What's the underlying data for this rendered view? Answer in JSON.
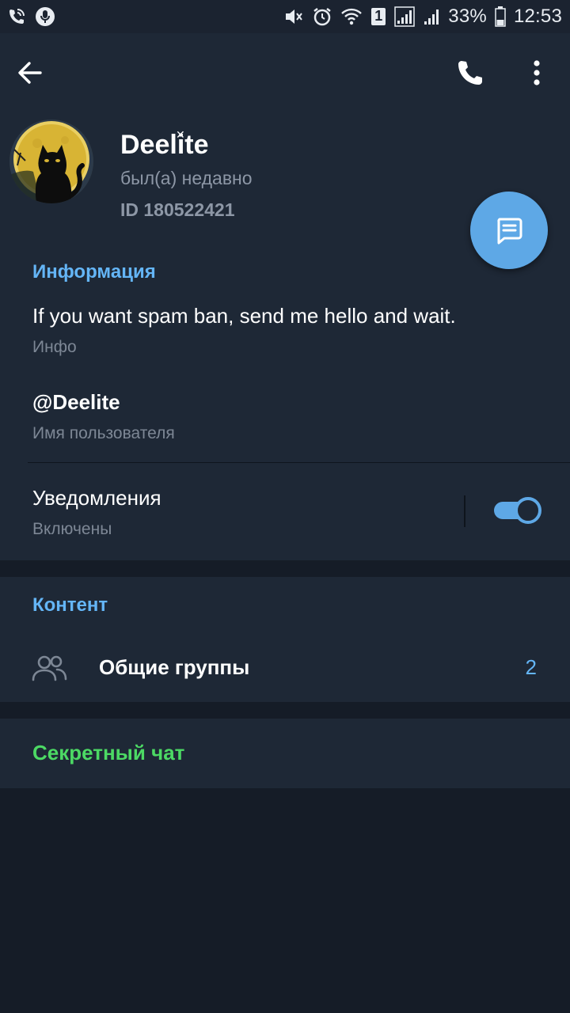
{
  "status_bar": {
    "battery": "33%",
    "time": "12:53",
    "sim_badge": "1"
  },
  "toolbar": {
    "back_icon": "arrow-left-icon",
    "call_icon": "phone-icon",
    "more_icon": "more-vertical-icon"
  },
  "profile": {
    "name": "Deelite",
    "status": "был(а) недавно",
    "id": "ID 180522421"
  },
  "info": {
    "title": "Информация",
    "bio": "If you want spam ban, send me hello and wait.",
    "bio_label": "Инфо",
    "username": "@Deelite",
    "username_label": "Имя пользователя",
    "notifications": "Уведомления",
    "notifications_state": "Включены",
    "notifications_on": true
  },
  "content": {
    "title": "Контент",
    "groups_label": "Общие группы",
    "groups_count": "2"
  },
  "secret": {
    "label": "Секретный чат"
  },
  "colors": {
    "accent": "#64b5f6",
    "fab": "#5ea8e6",
    "secret": "#4cd964",
    "panel": "#1e2836",
    "background": "#151c27"
  }
}
